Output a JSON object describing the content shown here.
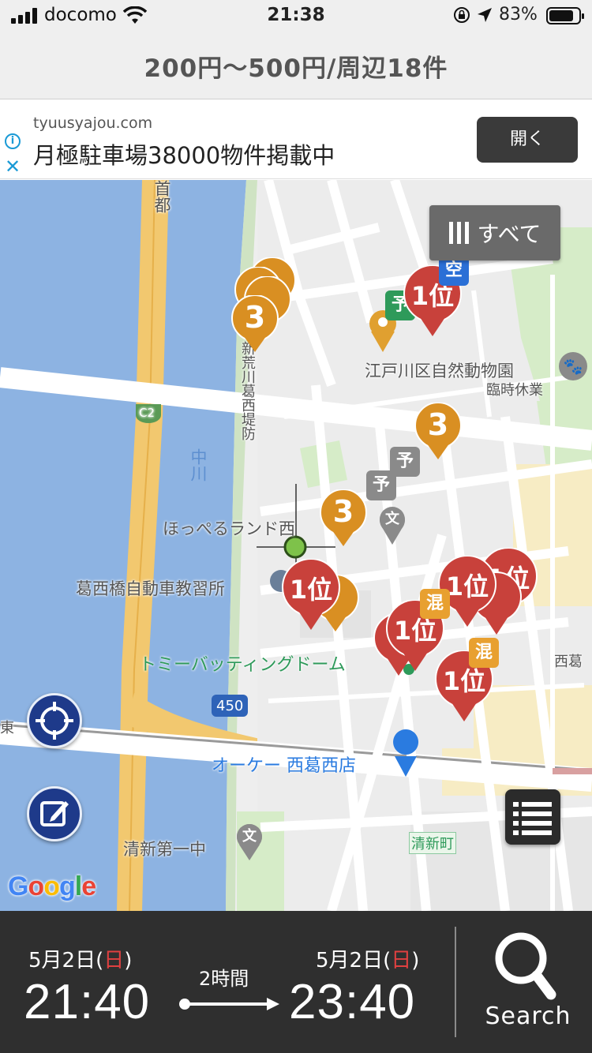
{
  "status": {
    "carrier": "docomo",
    "time": "21:38",
    "battery": "83%",
    "battery_level": 0.83
  },
  "header": {
    "title": "200円〜500円/周辺18件"
  },
  "ad": {
    "domain": "tyuusyajou.com",
    "headline": "月極駐車場38000物件掲載中",
    "open_label": "開く"
  },
  "map": {
    "filter_label": "すべて",
    "labels": {
      "road_shuto": "首都",
      "road_shinarakawa": "新荒川葛西堤防",
      "c2": "C2",
      "nakagawa": "中川",
      "route450": "450",
      "zoo": "江戸川区自然動物園",
      "zoo_note": "臨時休業",
      "hopperu": "ほっぺるランド西",
      "kasai_school": "葛西橋自動車教習所",
      "tommy": "トミーバッティングドーム",
      "ok_store": "オーケー 西葛西店",
      "seishin": "清新第一中",
      "seishincho": "清新町",
      "nishikasai": "西葛",
      "tozai": "東",
      "google": "Google"
    },
    "pins": {
      "rank1": "1位",
      "rank3": "3",
      "tag_empty": "空",
      "tag_reserve": "予",
      "tag_mixed": "混",
      "tag_school": "文"
    }
  },
  "bottom": {
    "start_date": "5月2日(",
    "start_dow": "日",
    "start_date_end": ")",
    "start_time": "21:40",
    "duration": "2時間",
    "end_date": "5月2日(",
    "end_dow": "日",
    "end_date_end": ")",
    "end_time": "23:40",
    "search_label": "Search"
  },
  "colors": {
    "rank1_pin": "#c8413b",
    "rank3_pin": "#d98f22",
    "water": "#8db3e2",
    "highway": "#f2c86f",
    "nav_button": "#1e3a8a"
  }
}
